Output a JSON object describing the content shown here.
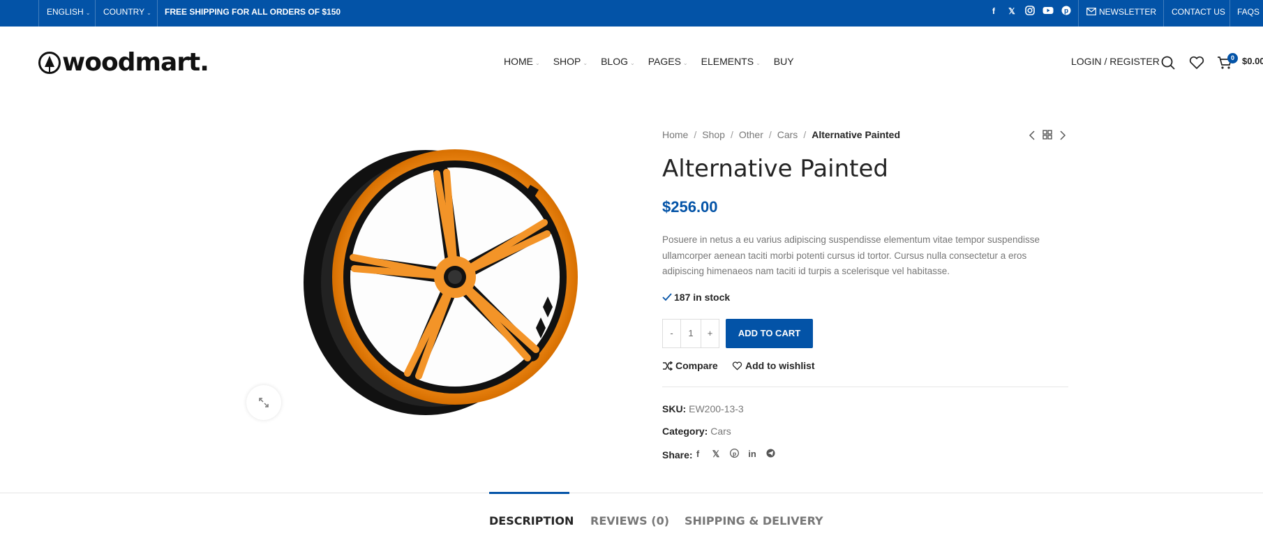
{
  "topbar": {
    "language": "ENGLISH",
    "country": "COUNTRY",
    "promo": "FREE SHIPPING FOR ALL ORDERS OF $150",
    "social_icons": [
      "facebook-icon",
      "x-icon",
      "instagram-icon",
      "youtube-icon",
      "pinterest-icon"
    ],
    "newsletter": "NEWSLETTER",
    "contact": "CONTACT US",
    "faqs": "FAQS",
    "bg_color": "#0353a7"
  },
  "header": {
    "logo_text": "woodmart.",
    "nav": [
      "HOME",
      "SHOP",
      "BLOG",
      "PAGES",
      "ELEMENTS",
      "BUY"
    ],
    "login": "LOGIN / REGISTER",
    "cart_count": "0",
    "cart_total": "$0.00"
  },
  "breadcrumb": {
    "items": [
      "Home",
      "Shop",
      "Other",
      "Cars"
    ],
    "current": "Alternative Painted"
  },
  "product": {
    "title": "Alternative Painted",
    "price": "$256.00",
    "description": "Posuere in netus a eu varius adipiscing suspendisse elementum vitae tempor suspendisse ullamcorper aenean taciti morbi potenti cursus id tortor. Cursus nulla consectetur a eros adipiscing himenaeos nam taciti id turpis a scelerisque vel habitasse.",
    "stock": "187 in stock",
    "qty_minus": "-",
    "qty_value": "1",
    "qty_plus": "+",
    "add_to_cart": "ADD TO CART",
    "compare": "Compare",
    "wishlist": "Add to wishlist",
    "sku_label": "SKU:",
    "sku": "EW200-13-3",
    "category_label": "Category:",
    "category": "Cars",
    "share_label": "Share:",
    "share_icons": [
      "facebook-icon",
      "x-icon",
      "pinterest-icon",
      "linkedin-icon",
      "telegram-icon"
    ]
  },
  "tabs": [
    "DESCRIPTION",
    "REVIEWS (0)",
    "SHIPPING & DELIVERY"
  ],
  "accent_color": "#0353a7"
}
